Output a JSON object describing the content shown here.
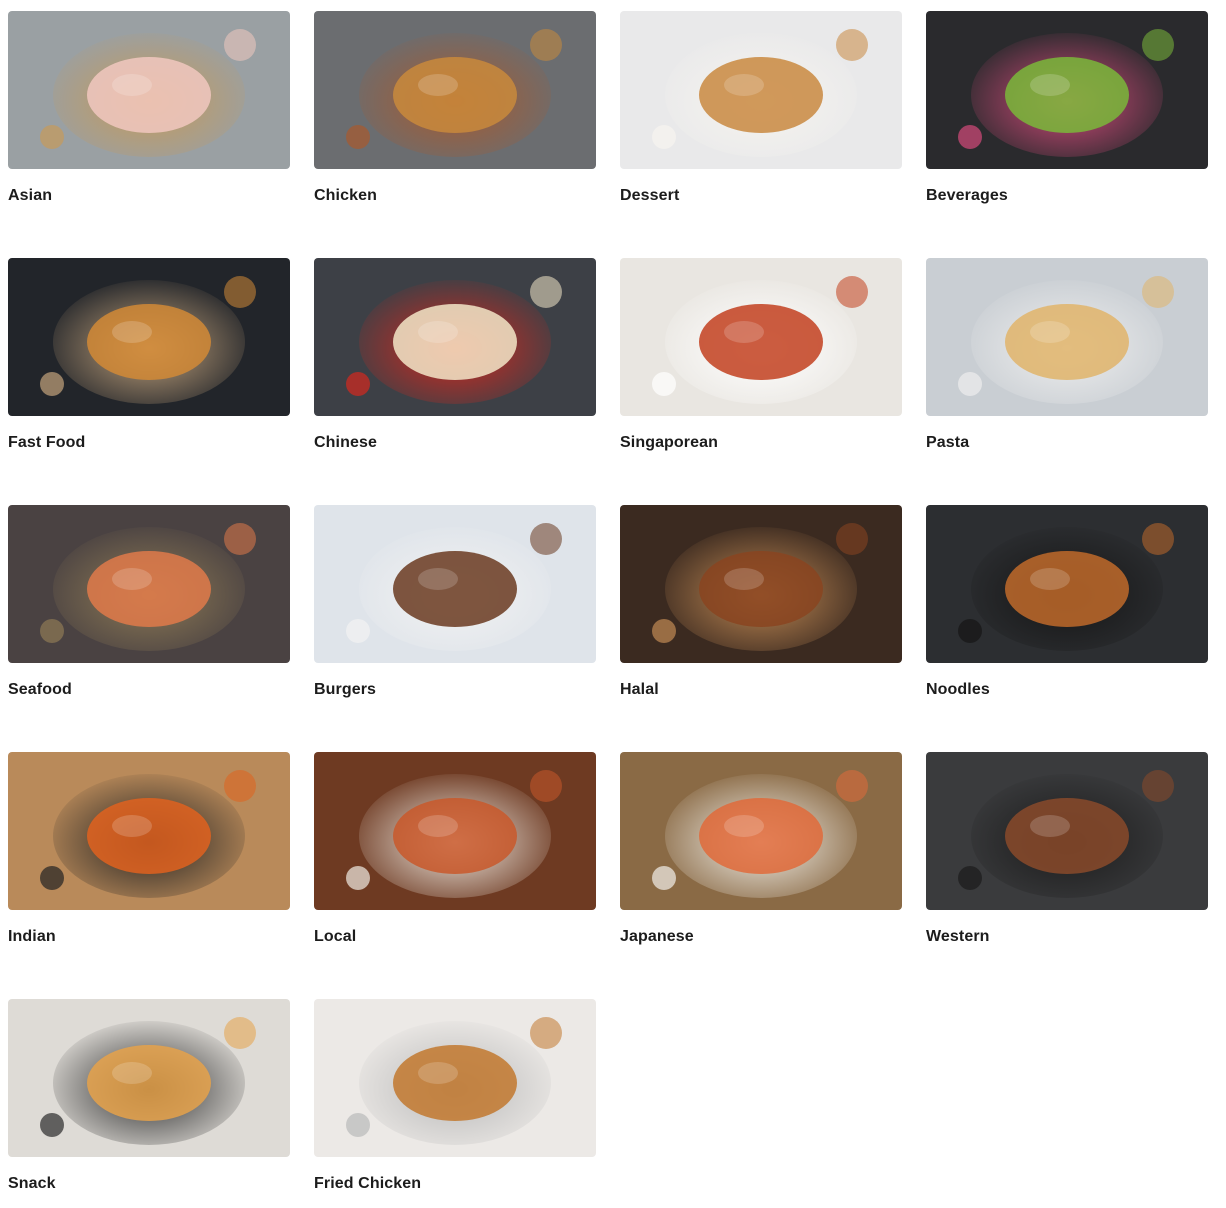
{
  "categories": [
    {
      "name": "Asian",
      "icon": "dim-sum-steamer-image",
      "colors": [
        "#9aa0a3",
        "#c69a5a",
        "#f1c8c0"
      ]
    },
    {
      "name": "Chicken",
      "icon": "roast-chicken-image",
      "colors": [
        "#6b6d70",
        "#a85a2e",
        "#c98a3c"
      ]
    },
    {
      "name": "Dessert",
      "icon": "cupcakes-image",
      "colors": [
        "#e9e9ea",
        "#f6f4ef",
        "#c9883f"
      ]
    },
    {
      "name": "Beverages",
      "icon": "smoothies-image",
      "colors": [
        "#2a2a2d",
        "#d44a7a",
        "#7ab83a"
      ]
    },
    {
      "name": "Fast Food",
      "icon": "burgers-on-paper-image",
      "colors": [
        "#22252a",
        "#c3a37c",
        "#d28a36"
      ]
    },
    {
      "name": "Chinese",
      "icon": "noodle-soup-image",
      "colors": [
        "#3d4046",
        "#d4281e",
        "#f3e6c8"
      ]
    },
    {
      "name": "Singaporean",
      "icon": "chilli-crab-image",
      "colors": [
        "#e9e6e1",
        "#ffffff",
        "#c2401e"
      ]
    },
    {
      "name": "Pasta",
      "icon": "pasta-plate-image",
      "colors": [
        "#c9ced3",
        "#eeeeee",
        "#e0b46a"
      ]
    },
    {
      "name": "Seafood",
      "icon": "prawn-pan-image",
      "colors": [
        "#4a4242",
        "#8e7a55",
        "#e07a4a"
      ]
    },
    {
      "name": "Burgers",
      "icon": "burger-and-fries-image",
      "colors": [
        "#dfe4ea",
        "#f2f2f2",
        "#6a3a20"
      ]
    },
    {
      "name": "Halal",
      "icon": "rendang-image",
      "colors": [
        "#3b2a20",
        "#c28a54",
        "#8a4420"
      ]
    },
    {
      "name": "Noodles",
      "icon": "wok-noodles-image",
      "colors": [
        "#2c2e31",
        "#151515",
        "#c06a2a"
      ]
    },
    {
      "name": "Indian",
      "icon": "curry-and-naan-image",
      "colors": [
        "#b98a5a",
        "#222222",
        "#e0621e"
      ]
    },
    {
      "name": "Local",
      "icon": "curry-bowls-image",
      "colors": [
        "#6e3a22",
        "#f0ebe3",
        "#c9582a"
      ]
    },
    {
      "name": "Japanese",
      "icon": "sushi-image",
      "colors": [
        "#8a6a45",
        "#f2f0ea",
        "#e06a3a"
      ]
    },
    {
      "name": "Western",
      "icon": "steak-pan-image",
      "colors": [
        "#3a3b3d",
        "#1b1b1b",
        "#8a4a2a"
      ]
    },
    {
      "name": "Snack",
      "icon": "buns-image",
      "colors": [
        "#dedbd6",
        "#2b2b2b",
        "#e6a24a"
      ]
    },
    {
      "name": "Fried Chicken",
      "icon": "fried-chicken-basket-image",
      "colors": [
        "#ece9e6",
        "#b9b9b9",
        "#c2782e"
      ]
    }
  ]
}
